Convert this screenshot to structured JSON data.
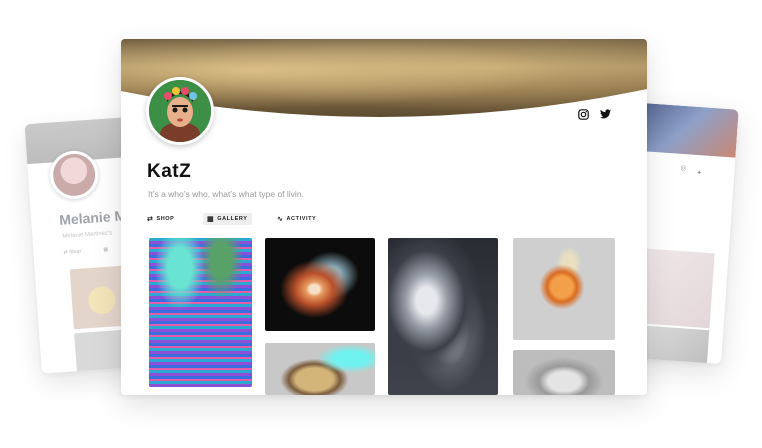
{
  "main_profile": {
    "name": "KatZ",
    "bio": "It’s a who’s who, what’s what type of livin.",
    "social": [
      "instagram-icon",
      "twitter-icon"
    ],
    "tabs": [
      {
        "label": "SHOP",
        "icon": "swap-icon",
        "active": false
      },
      {
        "label": "GALLERY",
        "icon": "grid-icon",
        "active": true
      },
      {
        "label": "ACTIVITY",
        "icon": "activity-icon",
        "active": false
      }
    ]
  },
  "left_profile": {
    "name": "Melanie M",
    "subtitle": "Melanie Martinez's",
    "tab_shop": "Shop"
  },
  "colors": {
    "text": "#111111",
    "muted": "#9a9a9a",
    "tab_active_bg": "#eeeeee"
  }
}
